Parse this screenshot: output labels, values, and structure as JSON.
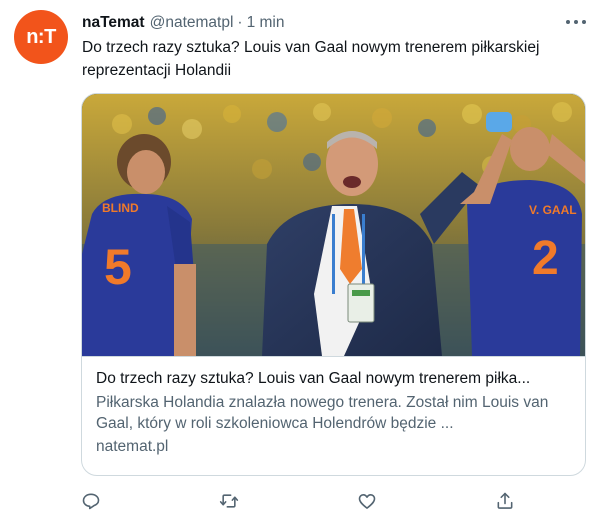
{
  "account": {
    "avatar_text": "n:T",
    "name": "naTemat",
    "handle": "@natematpl",
    "separator": "·",
    "time": "1 min"
  },
  "tweet": {
    "text": "Do trzech razy sztuka? Louis van Gaal nowym trenerem piłkarskiej reprezentacji Holandii"
  },
  "card": {
    "title": "Do trzech razy sztuka? Louis van Gaal nowym trenerem piłka...",
    "description": "Piłkarska Holandia znalazła nowego trenera. Został nim Louis van Gaal, który w roli szkoleniowca Holendrów będzie ...",
    "domain": "natemat.pl",
    "image": {
      "player_left_number": "5",
      "player_right_number": "2",
      "player_right_name": "V. GAAL",
      "player_left_name": "BLIND"
    }
  },
  "actions": {
    "icons": [
      "reply-icon",
      "retweet-icon",
      "like-icon",
      "share-icon"
    ]
  },
  "colors": {
    "brand": "#f2541b",
    "text": "#0f1419",
    "muted": "#536471",
    "border": "#cfd9de",
    "jersey": "#2a3a9a",
    "jersey_number": "#f07a2a"
  }
}
